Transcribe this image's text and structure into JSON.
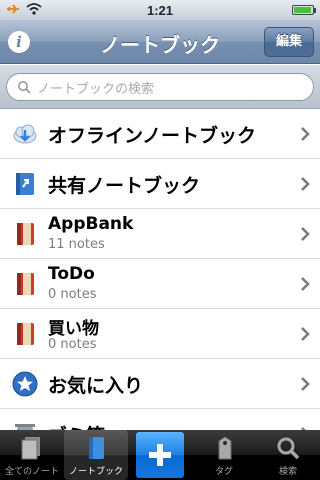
{
  "status_bar": {
    "time": "1:21",
    "icons": [
      "airplane-icon",
      "wifi-icon",
      "battery-icon"
    ]
  },
  "nav_bar": {
    "title": "ノートブック",
    "left_icon": "info-icon",
    "edit_label": "編集"
  },
  "search": {
    "placeholder": "ノートブックの検索",
    "icon": "search-icon"
  },
  "list": {
    "items": [
      {
        "label": "オフラインノートブック",
        "icon": "cloud-download-icon"
      },
      {
        "label": "共有ノートブック",
        "icon": "shared-notebook-icon"
      },
      {
        "label": "AppBank",
        "sub": "11 notes",
        "icon": "notebook-icon"
      },
      {
        "label": "ToDo",
        "sub": "0 notes",
        "icon": "notebook-icon"
      },
      {
        "label": "買い物",
        "sub": "0 notes",
        "icon": "notebook-icon"
      },
      {
        "label": "お気に入り",
        "icon": "star-icon"
      },
      {
        "label": "ゴミ箱",
        "icon": "trash-icon"
      }
    ]
  },
  "tab_bar": {
    "tabs": [
      {
        "label": "全てのノート",
        "icon": "all-notes-icon",
        "active": false
      },
      {
        "label": "ノートブック",
        "icon": "notebook-tab-icon",
        "active": true
      },
      {
        "label": "",
        "icon": "plus-icon",
        "active": false
      },
      {
        "label": "タグ",
        "icon": "tag-icon",
        "active": false
      },
      {
        "label": "検索",
        "icon": "search-icon",
        "active": false
      }
    ]
  },
  "colors": {
    "nav_bar": "#7891b1",
    "accent_blue": "#1e7fe0",
    "notebook_red": "#b5332b"
  }
}
